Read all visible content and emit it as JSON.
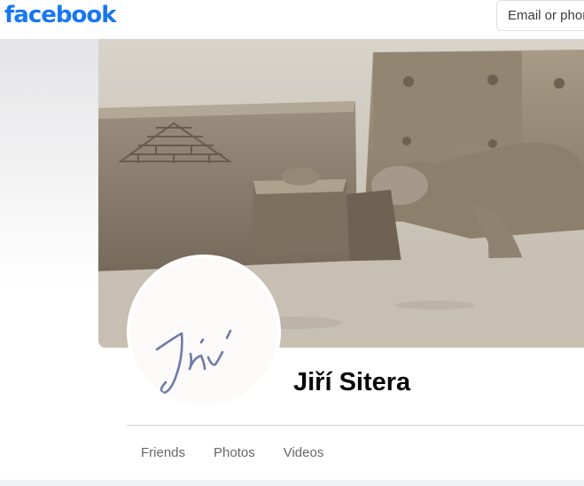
{
  "header": {
    "logo": "facebook",
    "email_placeholder": "Email or phone"
  },
  "cover": {
    "description_icon": "sand-sculpture-photo"
  },
  "profile": {
    "name": "Jiří Sitera",
    "avatar_icon": "signature-avatar"
  },
  "tabs": [
    {
      "label": "Friends"
    },
    {
      "label": "Photos"
    },
    {
      "label": "Videos"
    }
  ],
  "colors": {
    "brand": "#1877f2",
    "tab_text": "#65676b",
    "name_text": "#050505"
  }
}
